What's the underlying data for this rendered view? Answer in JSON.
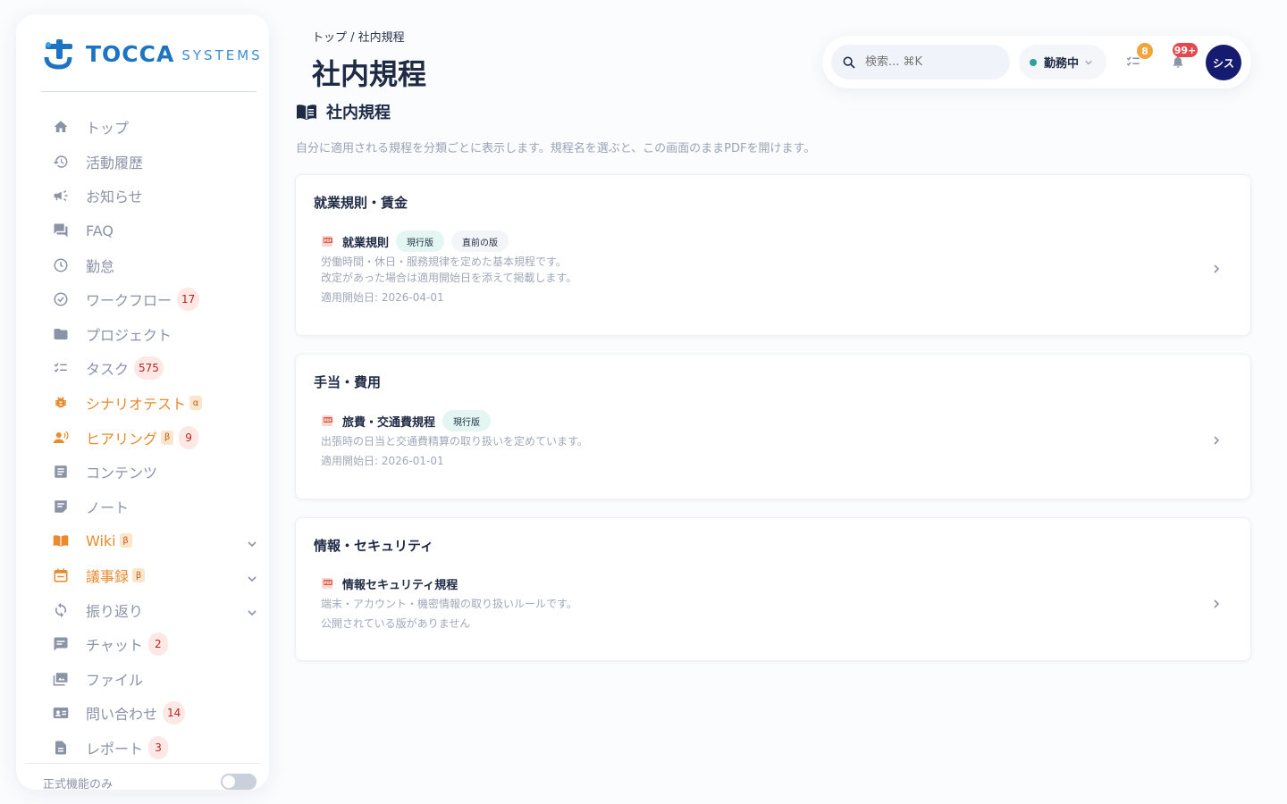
{
  "brand": {
    "name_primary": "TOCCA",
    "name_secondary": "SYSTEMS",
    "primary_color": "#1d74c2",
    "accent_color": "#e98a2c"
  },
  "sidebar": {
    "items": [
      {
        "label": "トップ",
        "icon": "home-icon",
        "color": "gray"
      },
      {
        "label": "活動履歴",
        "icon": "history-icon",
        "color": "gray"
      },
      {
        "label": "お知らせ",
        "icon": "megaphone-icon",
        "color": "gray"
      },
      {
        "label": "FAQ",
        "icon": "forum-icon",
        "color": "gray"
      },
      {
        "label": "勤怠",
        "icon": "clock-icon",
        "color": "gray"
      },
      {
        "label": "ワークフロー",
        "icon": "check-circle-icon",
        "color": "gray",
        "count": "17"
      },
      {
        "label": "プロジェクト",
        "icon": "folder-icon",
        "color": "gray"
      },
      {
        "label": "タスク",
        "icon": "checklist-icon",
        "color": "gray",
        "count": "575"
      },
      {
        "label": "シナリオテスト",
        "icon": "bug-icon",
        "color": "orange",
        "tag": "α"
      },
      {
        "label": "ヒアリング",
        "icon": "interview-icon",
        "color": "orange",
        "tag": "β",
        "count": "9"
      },
      {
        "label": "コンテンツ",
        "icon": "article-icon",
        "color": "gray"
      },
      {
        "label": "ノート",
        "icon": "note-icon",
        "color": "gray"
      },
      {
        "label": "Wiki",
        "icon": "book-icon",
        "color": "orange",
        "tag": "β",
        "expandable": true
      },
      {
        "label": "議事録",
        "icon": "calendar-icon",
        "color": "orange",
        "tag": "β",
        "expandable": true
      },
      {
        "label": "振り返り",
        "icon": "sync-icon",
        "color": "gray",
        "expandable": true
      },
      {
        "label": "チャット",
        "icon": "chat-icon",
        "color": "gray",
        "count": "2"
      },
      {
        "label": "ファイル",
        "icon": "images-icon",
        "color": "gray"
      },
      {
        "label": "問い合わせ",
        "icon": "contact-card-icon",
        "color": "gray",
        "count": "14"
      },
      {
        "label": "レポート",
        "icon": "report-icon",
        "color": "gray",
        "count": "3"
      }
    ],
    "footer_toggle_label": "正式機能のみ",
    "footer_toggle_on": false
  },
  "header": {
    "breadcrumb": "トップ  /  社内規程",
    "title": "社内規程"
  },
  "topbar": {
    "search_placeholder": "検索... ⌘K",
    "status_label": "勤務中",
    "tasks_badge": "8",
    "notifications_badge": "99+",
    "avatar_label": "シス"
  },
  "main": {
    "section_title": "社内規程",
    "section_description": "自分に適用される規程を分類ごとに表示します。規程名を選ぶと、この画面のままPDFを開けます。",
    "categories": [
      {
        "title": "就業規則・賃金",
        "documents": [
          {
            "name": "就業規則",
            "tags": [
              "現行版",
              "直前の版"
            ],
            "description_lines": [
              "労働時間・休日・服務規律を定めた基本規程です。",
              "改定があった場合は適用開始日を添えて掲載します。"
            ],
            "meta": "適用開始日: 2026-04-01"
          }
        ]
      },
      {
        "title": "手当・費用",
        "documents": [
          {
            "name": "旅費・交通費規程",
            "tags": [
              "現行版"
            ],
            "description_lines": [
              "出張時の日当と交通費精算の取り扱いを定めています。"
            ],
            "meta": "適用開始日: 2026-01-01"
          }
        ]
      },
      {
        "title": "情報・セキュリティ",
        "documents": [
          {
            "name": "情報セキュリティ規程",
            "tags": [],
            "description_lines": [
              "端末・アカウント・機密情報の取り扱いルールです。"
            ],
            "meta": "公開されている版がありません"
          }
        ]
      }
    ]
  }
}
